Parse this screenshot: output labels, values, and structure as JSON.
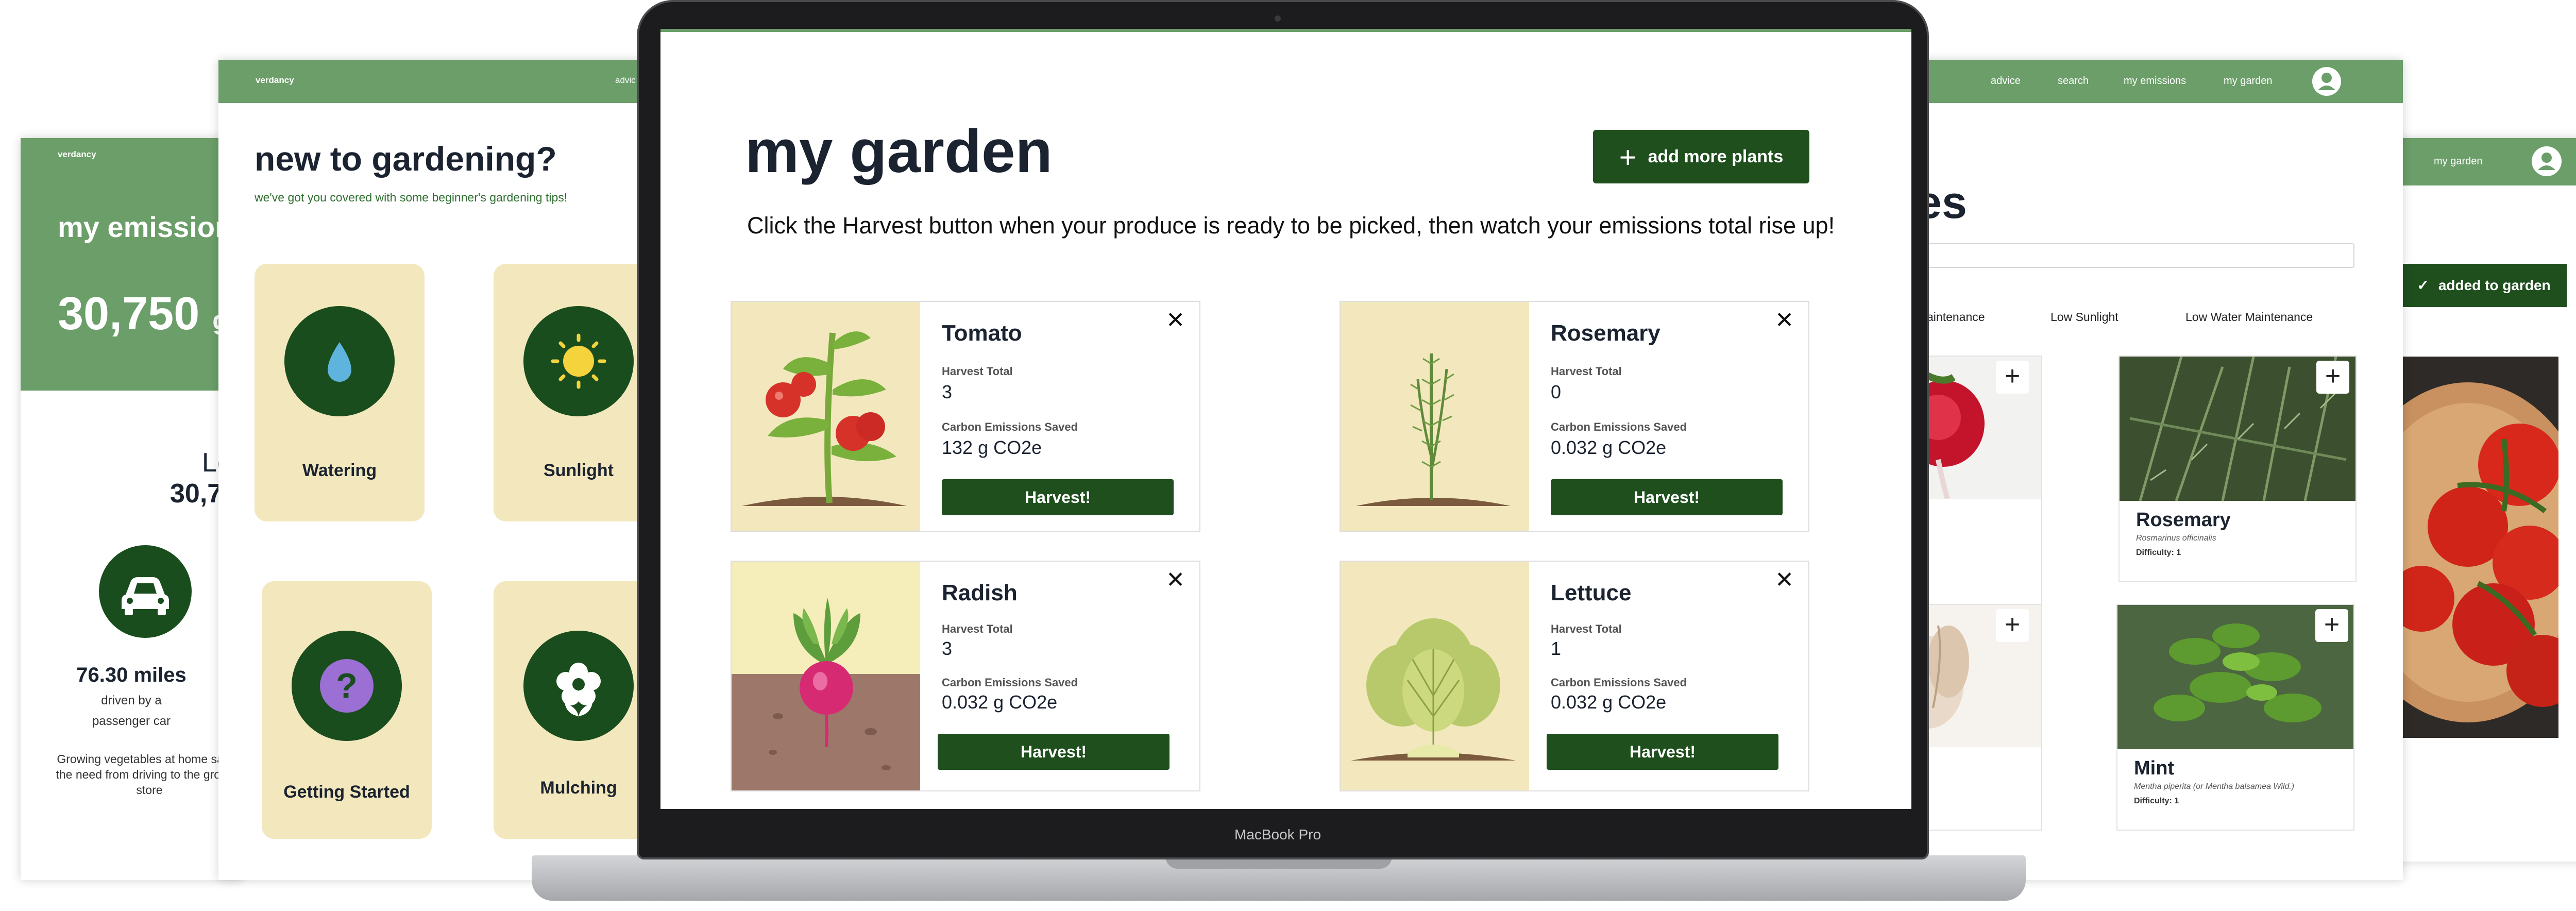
{
  "left_screen": {
    "brand": "verdancy",
    "title": "my emissions",
    "total": "30,750",
    "total_unit": "g",
    "subtitle_partial_1": "Le",
    "subtitle_partial_2": "30,7",
    "stat_value": "76.30 miles",
    "stat_line1": "driven by a",
    "stat_line2": "passenger car",
    "note": "Growing vegetables at home saves the need from driving to the grocery store",
    "car_icon": "car-icon"
  },
  "tips_screen": {
    "brand": "verdancy",
    "nav_partial": "advic",
    "title": "new to gardening?",
    "subtitle": "we've got you covered with some beginner's gardening tips!",
    "tips": [
      {
        "label": "Watering",
        "icon": "water-drop-icon"
      },
      {
        "label": "Sunlight",
        "icon": "sun-icon"
      },
      {
        "label": "Getting Started",
        "icon": "question-icon"
      },
      {
        "label": "Mulching",
        "icon": "flower-icon"
      }
    ]
  },
  "browse_screen": {
    "nav": [
      "advice",
      "search",
      "my emissions",
      "my garden"
    ],
    "title_partial": "es",
    "filters": [
      "aintenance",
      "Low Sunlight",
      "Low Water Maintenance"
    ],
    "cards": [
      {
        "name": "Rosemary",
        "latin": "Rosmarinus officinalis",
        "difficulty": "Difficulty: 1"
      },
      {
        "name": "Mint",
        "latin": "Mentha piperita (or Mentha balsamea Wild.)",
        "difficulty": "Difficulty: 1"
      }
    ]
  },
  "detail_screen": {
    "nav": "my garden",
    "added_button": "added to garden"
  },
  "laptop": {
    "label": "MacBook Pro",
    "title": "my garden",
    "add_button": "add more plants",
    "instructions": "Click the Harvest button when your produce is ready to be picked, then watch your emissions total rise up!",
    "harvest_total_label": "Harvest Total",
    "carbon_label": "Carbon Emissions Saved",
    "harvest_button": "Harvest!",
    "close_glyph": "✕",
    "plants": [
      {
        "name": "Tomato",
        "harvest_total": "3",
        "carbon": "132 g CO2e"
      },
      {
        "name": "Rosemary",
        "harvest_total": "0",
        "carbon": "0.032 g CO2e"
      },
      {
        "name": "Radish",
        "harvest_total": "3",
        "carbon": "0.032 g CO2e"
      },
      {
        "name": "Lettuce",
        "harvest_total": "1",
        "carbon": "0.032 g CO2e"
      }
    ]
  },
  "colors": {
    "nav_green": "#6b9e69",
    "dark_green": "#1e4f1d",
    "tan": "#f3e8bd"
  }
}
